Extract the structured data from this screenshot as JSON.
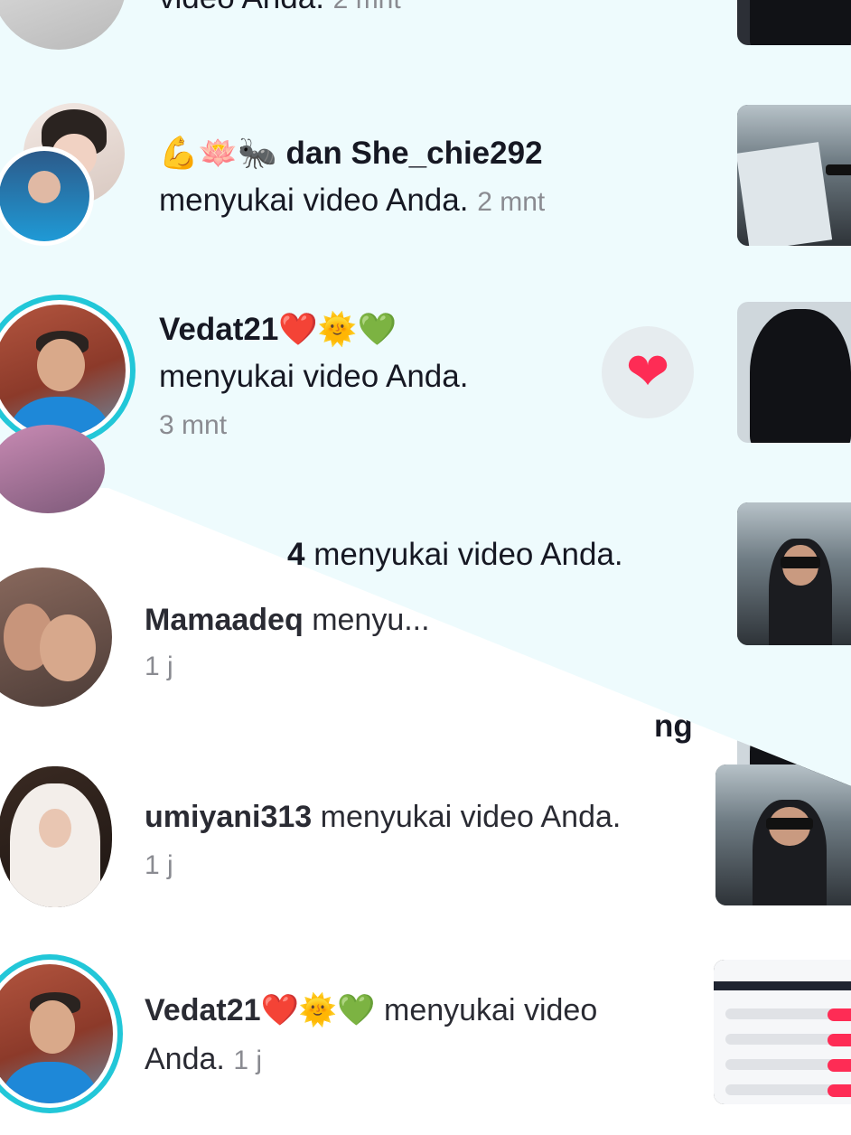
{
  "notifications_top": [
    {
      "partial_text": "video Anda.",
      "time": "2 mnt"
    },
    {
      "user_prefix_emojis": "💪🪷🐜",
      "connector": "dan",
      "user": "She_chie292",
      "action": "menyukai video Anda.",
      "time": "2 mnt"
    },
    {
      "user": "Vedat21",
      "user_emojis": "❤️🌞💚",
      "action": "menyukai video Anda.",
      "time": "3 mnt",
      "like_icon": "heart-icon"
    },
    {
      "partial_user": "4",
      "action": "menyukai video Anda."
    }
  ],
  "notifications_bottom": [
    {
      "user": "Mamaadeq",
      "partial_action": "menyu...",
      "time": "1 j"
    },
    {
      "partial_text": "ng"
    },
    {
      "user": "umiyani313",
      "action": "menyukai video Anda.",
      "time": "1 j"
    },
    {
      "user": "Vedat21",
      "user_emojis": "❤️🌞💚",
      "action_line1": "menyukai video",
      "action_line2": "Anda.",
      "time": "1 j"
    }
  ],
  "colors": {
    "accent_like": "#fe2c55",
    "story_ring": "#22c7d8",
    "top_background": "#eefbfd",
    "time_gray": "#8a8b91"
  }
}
